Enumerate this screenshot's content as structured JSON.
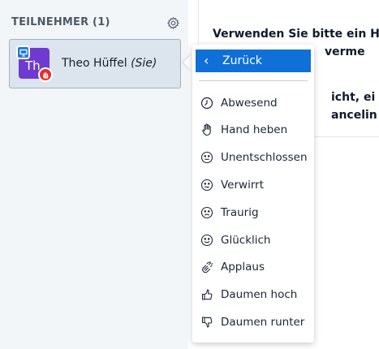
{
  "sidebar": {
    "title": "TEILNEHMER (1)",
    "user": {
      "initials": "Th",
      "name": "Theo Hüffel",
      "suffix": "(Sie)",
      "avatar_color": "#6e3ad0"
    }
  },
  "main": {
    "line1": "Verwenden Sie bitte ein He",
    "line2": "verme",
    "line3": "icht, ei",
    "line4": "ancelin"
  },
  "status_menu": {
    "back_label": "Zurück",
    "items": [
      {
        "label": "Abwesend",
        "icon": "clock-icon"
      },
      {
        "label": "Hand heben",
        "icon": "hand-icon"
      },
      {
        "label": "Unentschlossen",
        "icon": "neutral-face-icon"
      },
      {
        "label": "Verwirrt",
        "icon": "confused-face-icon"
      },
      {
        "label": "Traurig",
        "icon": "sad-face-icon"
      },
      {
        "label": "Glücklich",
        "icon": "happy-face-icon"
      },
      {
        "label": "Applaus",
        "icon": "applause-icon"
      },
      {
        "label": "Daumen hoch",
        "icon": "thumbs-up-icon"
      },
      {
        "label": "Daumen runter",
        "icon": "thumbs-down-icon"
      }
    ],
    "accent_color": "#0f70d7"
  }
}
